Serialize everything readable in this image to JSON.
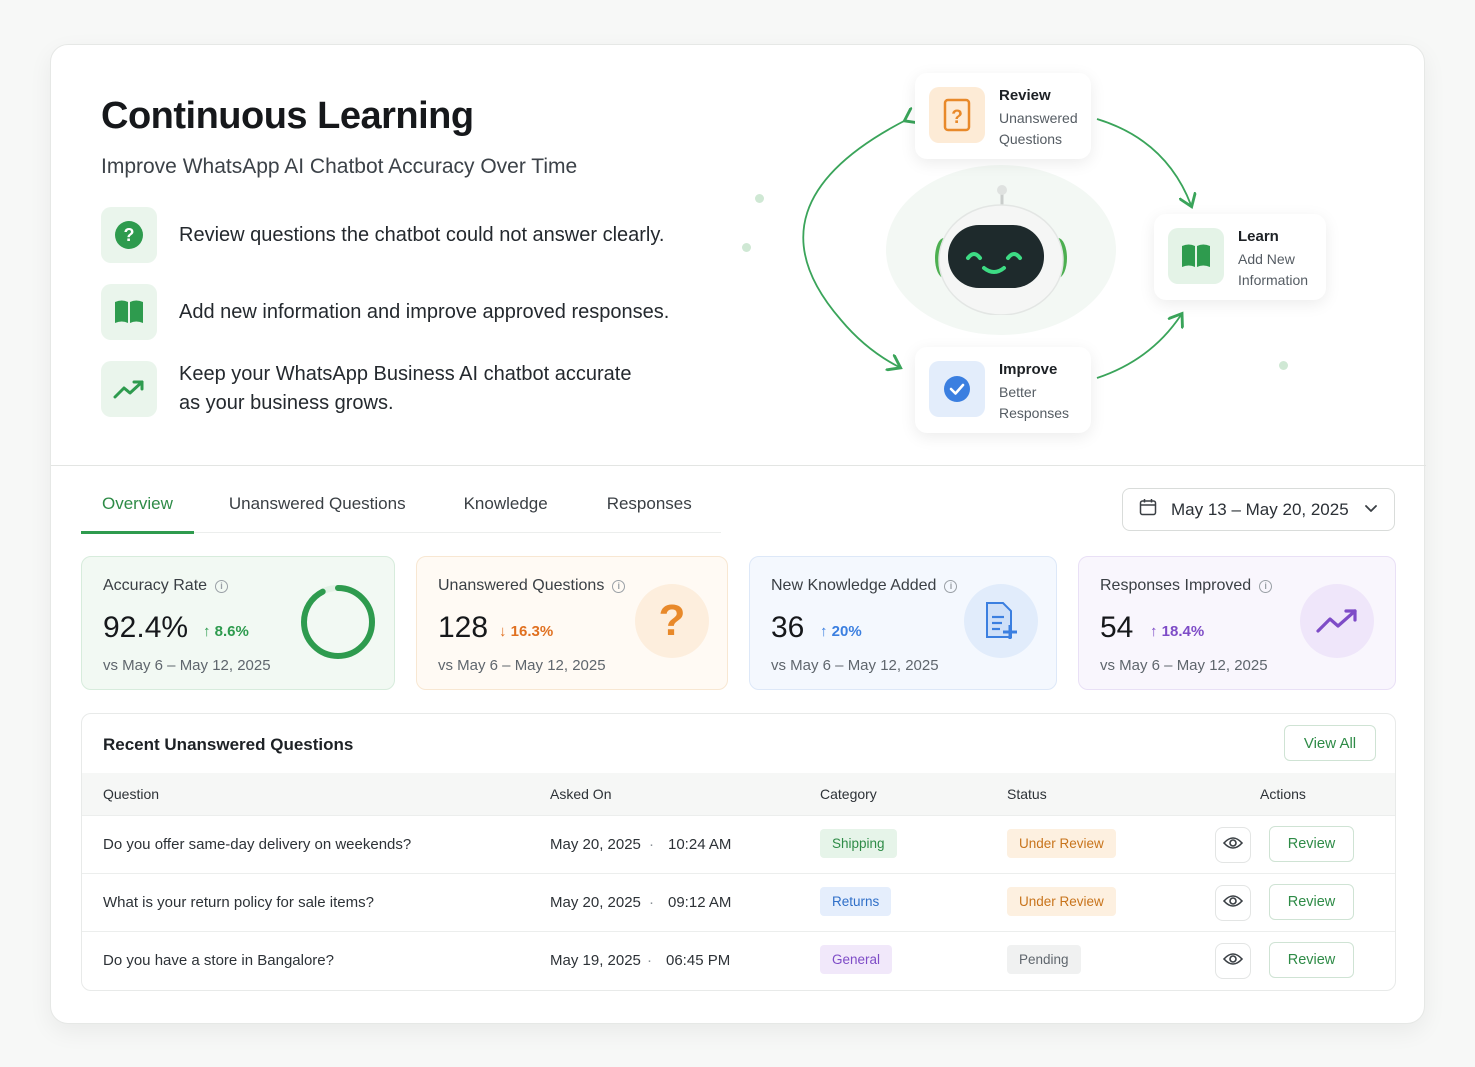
{
  "hero": {
    "title": "Continuous Learning",
    "subtitle": "Improve WhatsApp AI Chatbot Accuracy Over Time",
    "features": [
      {
        "icon": "question-circle-icon",
        "text": "Review questions the chatbot could not answer clearly."
      },
      {
        "icon": "open-book-icon",
        "text": "Add new information and improve approved responses."
      },
      {
        "icon": "trending-up-icon",
        "text_line1": "Keep your WhatsApp Business AI chatbot accurate",
        "text_line2": "as your business grows."
      }
    ],
    "cycle": {
      "review": {
        "title": "Review",
        "line1": "Unanswered",
        "line2": "Questions",
        "icon": "question-doc-icon"
      },
      "learn": {
        "title": "Learn",
        "line1": "Add New",
        "line2": "Information",
        "icon": "open-book-icon"
      },
      "improve": {
        "title": "Improve",
        "line1": "Better",
        "line2": "Responses",
        "icon": "check-badge-icon"
      },
      "center_icon": "robot-icon"
    }
  },
  "tabs": [
    "Overview",
    "Unanswered Questions",
    "Knowledge",
    "Responses"
  ],
  "active_tab": "Overview",
  "date_range": {
    "label": "May 13 – May 20, 2025",
    "icon": "calendar-icon"
  },
  "stats": [
    {
      "label": "Accuracy Rate",
      "value": "92.4%",
      "delta": "8.6%",
      "direction": "up",
      "compare": "vs May 6 – May 12, 2025",
      "progress": 0.924,
      "color": "#2e9b4e"
    },
    {
      "label": "Unanswered Questions",
      "value": "128",
      "delta": "16.3%",
      "direction": "down",
      "compare": "vs May 6 – May 12, 2025",
      "icon": "question-mark-icon",
      "color": "#e8892a"
    },
    {
      "label": "New Knowledge Added",
      "value": "36",
      "delta": "20%",
      "direction": "up",
      "compare": "vs May 6 – May 12, 2025",
      "icon": "document-add-icon",
      "color": "#3b7fe0"
    },
    {
      "label": "Responses Improved",
      "value": "54",
      "delta": "18.4%",
      "direction": "up",
      "compare": "vs May 6 – May 12, 2025",
      "icon": "trending-up-icon",
      "color": "#7e4cc7"
    }
  ],
  "table": {
    "title": "Recent Unanswered Questions",
    "view_all": "View All",
    "headers": [
      "Question",
      "Asked On",
      "Category",
      "Status",
      "Actions"
    ],
    "rows": [
      {
        "question": "Do you offer same-day delivery on weekends?",
        "date": "May 20, 2025",
        "time": "10:24 AM",
        "category": "Shipping",
        "status": "Under Review",
        "action": "Review"
      },
      {
        "question": "What is your return policy for sale items?",
        "date": "May 20, 2025",
        "time": "09:12 AM",
        "category": "Returns",
        "status": "Under Review",
        "action": "Review"
      },
      {
        "question": "Do you have a store in Bangalore?",
        "date": "May 19, 2025",
        "time": "06:45 PM",
        "category": "General",
        "status": "Pending",
        "action": "Review"
      }
    ],
    "separator": "·"
  },
  "colors": {
    "brand_green": "#2e9b4e",
    "orange": "#e8892a",
    "blue": "#3b7fe0",
    "purple": "#7e4cc7"
  }
}
